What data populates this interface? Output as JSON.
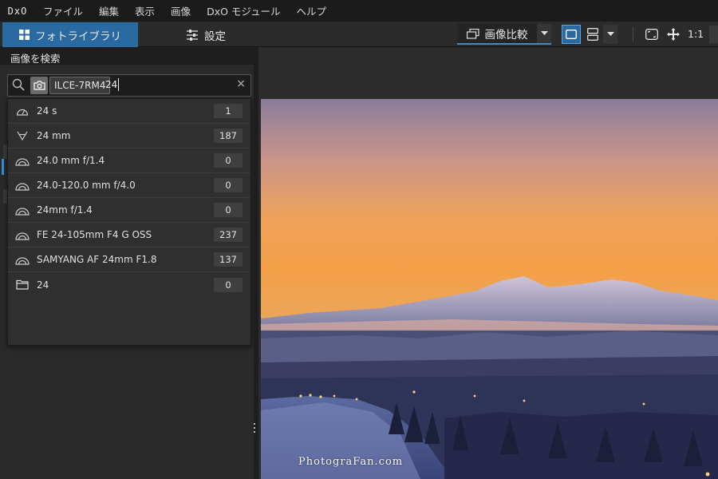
{
  "app": {
    "logo_text": "DxO"
  },
  "menu": [
    {
      "label": "ファイル"
    },
    {
      "label": "編集"
    },
    {
      "label": "表示"
    },
    {
      "label": "画像"
    },
    {
      "label": "DxO モジュール"
    },
    {
      "label": "ヘルプ"
    }
  ],
  "toolbar": {
    "library_tab": "フォトライブラリ",
    "settings_tab": "設定",
    "compare_label": "画像比較",
    "zoom_label": "1:1",
    "accent_color": "#2a6aa0"
  },
  "search_panel": {
    "title": "画像を検索",
    "token": "ILCE-7RM4",
    "query": "24",
    "clear_symbol": "×"
  },
  "suggestions": [
    {
      "icon": "shutter-speed-icon",
      "label": "24 s",
      "count": "1"
    },
    {
      "icon": "focal-length-icon",
      "label": "24 mm",
      "count": "187"
    },
    {
      "icon": "lens-icon",
      "label": "24.0 mm f/1.4",
      "count": "0"
    },
    {
      "icon": "lens-icon",
      "label": "24.0-120.0 mm f/4.0",
      "count": "0"
    },
    {
      "icon": "lens-icon",
      "label": "24mm f/1.4",
      "count": "0"
    },
    {
      "icon": "lens-icon",
      "label": "FE 24-105mm F4 G OSS",
      "count": "237"
    },
    {
      "icon": "lens-icon",
      "label": "SAMYANG AF 24mm F1.8",
      "count": "137"
    },
    {
      "icon": "folder-icon",
      "label": "24",
      "count": "0"
    }
  ],
  "viewer": {
    "watermark": "PhotograFan.com"
  }
}
